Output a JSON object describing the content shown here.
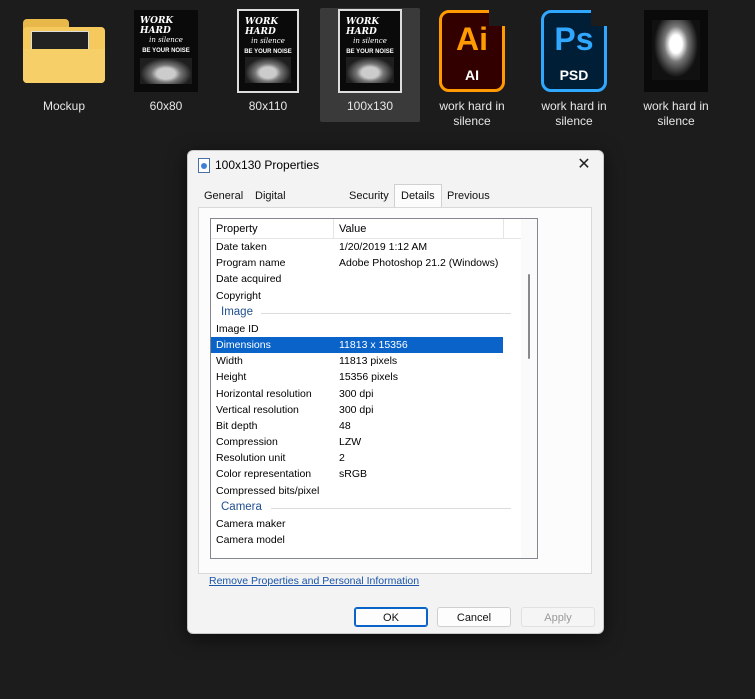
{
  "files": [
    {
      "label": "Mockup",
      "icon": "folder-icon"
    },
    {
      "label": "60x80",
      "icon": "poster-thumbnail-icon",
      "poster": {
        "line1": "WORK HARD",
        "line2": "in silence",
        "line3": "BE YOUR NOISE"
      }
    },
    {
      "label": "80x110",
      "icon": "poster-thumbnail-icon",
      "poster": {
        "line1": "WORK HARD",
        "line2": "in silence",
        "line3": "BE YOUR NOISE"
      }
    },
    {
      "label": "100x130",
      "icon": "poster-thumbnail-icon",
      "poster": {
        "line1": "WORK HARD",
        "line2": "in silence",
        "line3": "BE YOUR NOISE"
      }
    },
    {
      "label": "work hard in silence",
      "icon": "illustrator-file-icon",
      "app": {
        "big": "Ai",
        "small": "AI"
      }
    },
    {
      "label": "work hard in silence",
      "icon": "photoshop-file-icon",
      "app": {
        "big": "Ps",
        "small": "PSD"
      }
    },
    {
      "label": "work hard in silence",
      "icon": "image-thumbnail-icon"
    }
  ],
  "dialog": {
    "title": "100x130 Properties",
    "close_glyph": "✕",
    "tabs": [
      "General",
      "Digital Signatures",
      "Security",
      "Details",
      "Previous Versions"
    ],
    "active_tab": "Details",
    "columns": {
      "property": "Property",
      "value": "Value"
    },
    "rows": [
      {
        "k": "Date taken",
        "v": "1/20/2019 1:12 AM"
      },
      {
        "k": "Program name",
        "v": "Adobe Photoshop 21.2 (Windows)"
      },
      {
        "k": "Date acquired",
        "v": ""
      },
      {
        "k": "Copyright",
        "v": ""
      }
    ],
    "group_image": "Image",
    "image_rows": [
      {
        "k": "Image ID",
        "v": ""
      },
      {
        "k": "Dimensions",
        "v": "11813 x 15356"
      },
      {
        "k": "Width",
        "v": "11813 pixels"
      },
      {
        "k": "Height",
        "v": "15356 pixels"
      },
      {
        "k": "Horizontal resolution",
        "v": "300 dpi"
      },
      {
        "k": "Vertical resolution",
        "v": "300 dpi"
      },
      {
        "k": "Bit depth",
        "v": "48"
      },
      {
        "k": "Compression",
        "v": "LZW"
      },
      {
        "k": "Resolution unit",
        "v": "2"
      },
      {
        "k": "Color representation",
        "v": "sRGB"
      },
      {
        "k": "Compressed bits/pixel",
        "v": ""
      }
    ],
    "group_camera": "Camera",
    "camera_rows": [
      {
        "k": "Camera maker",
        "v": ""
      },
      {
        "k": "Camera model",
        "v": ""
      }
    ],
    "link": "Remove Properties and Personal Information",
    "buttons": {
      "ok": "OK",
      "cancel": "Cancel",
      "apply": "Apply"
    }
  },
  "colors": {
    "background": "#1c1c1c",
    "selection": "#0a63c9",
    "link": "#1a55a8"
  }
}
